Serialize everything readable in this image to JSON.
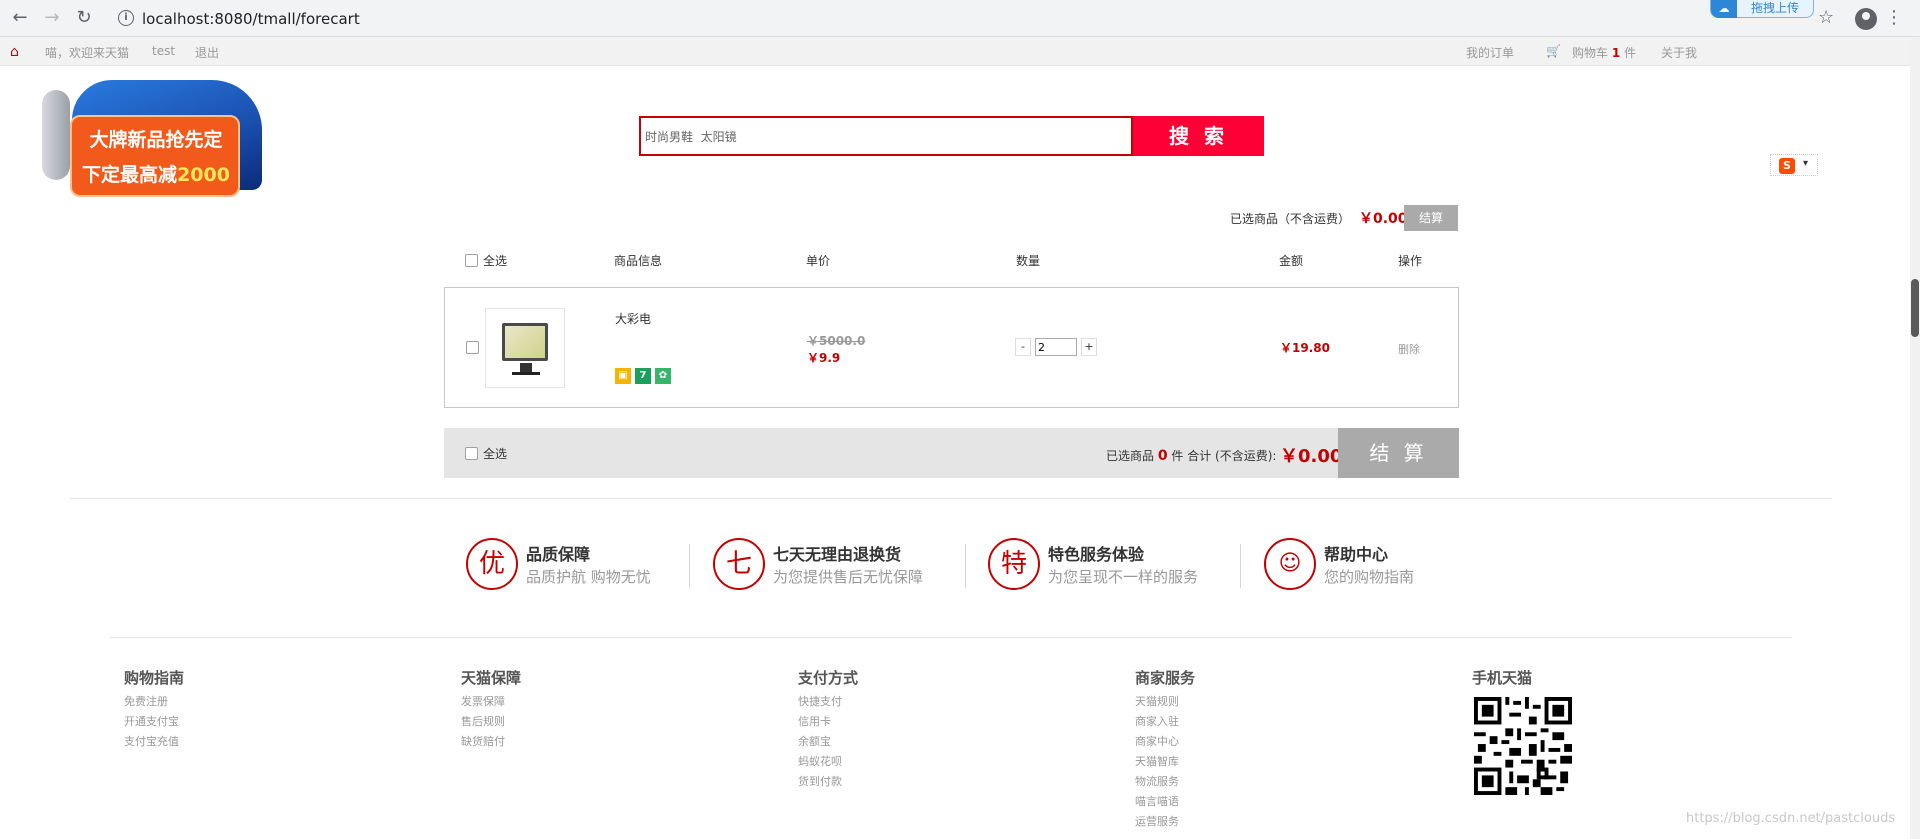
{
  "browser": {
    "url": "localhost:8080/tmall/forecart",
    "upload_label": "拖拽上传"
  },
  "topbar": {
    "welcome": "喵，欢迎来天猫",
    "username": "test",
    "logout": "退出",
    "my_orders": "我的订单",
    "cart_prefix": "购物车",
    "cart_count": "1",
    "cart_suffix": "件",
    "about": "关于我"
  },
  "banner": {
    "line1": "大牌新品抢先定",
    "line2_prefix": "下定最高减",
    "line2_amount": "2000"
  },
  "search": {
    "value": "时尚男鞋  太阳镜",
    "button": "搜 索"
  },
  "cart": {
    "selected_label": "已选商品（不含运费）",
    "selected_price": "￥0.00",
    "settle_small": "结算",
    "headers": {
      "select_all": "全选",
      "info": "商品信息",
      "unit_price": "单价",
      "quantity": "数量",
      "amount": "金额",
      "action": "操作"
    },
    "item": {
      "name": "大彩电",
      "old_price": "￥5000.0",
      "new_price": "￥9.9",
      "quantity": "2",
      "minus": "-",
      "plus": "+",
      "total": "￥19.80",
      "delete": "删除"
    },
    "footer": {
      "select_all": "全选",
      "prefix": "已选商品",
      "count": "0",
      "mid": "件 合计 (不含运费):",
      "total": "￥0.00",
      "settle": "结 算"
    }
  },
  "services": [
    {
      "icon": "优",
      "title": "品质保障",
      "subtitle": "品质护航 购物无忧"
    },
    {
      "icon": "七",
      "title": "七天无理由退换货",
      "subtitle": "为您提供售后无忧保障"
    },
    {
      "icon": "特",
      "title": "特色服务体验",
      "subtitle": "为您呈现不一样的服务"
    },
    {
      "icon": "",
      "title": "帮助中心",
      "subtitle": "您的购物指南"
    }
  ],
  "footer_columns": [
    {
      "heading": "购物指南",
      "items": [
        "免费注册",
        "开通支付宝",
        "支付宝充值"
      ]
    },
    {
      "heading": "天猫保障",
      "items": [
        "发票保障",
        "售后规则",
        "缺货赔付"
      ]
    },
    {
      "heading": "支付方式",
      "items": [
        "快捷支付",
        "信用卡",
        "余额宝",
        "蚂蚁花呗",
        "货到付款"
      ]
    },
    {
      "heading": "商家服务",
      "items": [
        "天猫规则",
        "商家入驻",
        "商家中心",
        "天猫智库",
        "物流服务",
        "喵言喵语",
        "运营服务"
      ]
    },
    {
      "heading": "手机天猫",
      "items": []
    }
  ],
  "watermark": "https://blog.csdn.net/pastclouds",
  "colors": {
    "brand_red": "#c40000",
    "search_red": "#ff0036",
    "settle_gray": "#aaaaaa"
  }
}
